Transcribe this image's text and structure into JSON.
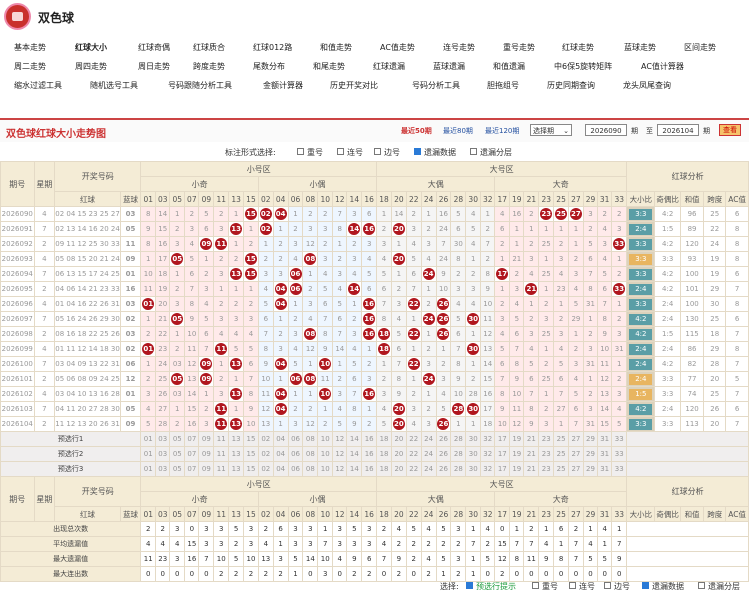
{
  "app_title": "双色球",
  "nav": [
    [
      {
        "label": "基本走势"
      },
      {
        "label": "红球大小",
        "active": true
      },
      {
        "label": "红球奇偶"
      },
      {
        "label": "红球质合"
      },
      {
        "label": "红球012路"
      },
      {
        "label": "和值走势"
      },
      {
        "label": "AC值走势"
      },
      {
        "label": "连号走势"
      },
      {
        "label": "重号走势"
      },
      {
        "label": "红球走势"
      },
      {
        "label": "蓝球走势"
      },
      {
        "label": "区间走势"
      }
    ],
    [
      {
        "label": "周二走势"
      },
      {
        "label": "周四走势"
      },
      {
        "label": "周日走势"
      },
      {
        "label": "跨度走势"
      },
      {
        "label": "尾数分布"
      },
      {
        "label": "和尾走势"
      },
      {
        "label": "红球遗漏"
      },
      {
        "label": "蓝球遗漏"
      },
      {
        "label": "和值遗漏"
      },
      {
        "label": "中6保5旋转矩阵"
      },
      {
        "label": "AC值计算器"
      }
    ],
    [
      {
        "label": "缩水过滤工具"
      },
      {
        "label": "随机选号工具"
      },
      {
        "label": "号码跟随分析工具"
      },
      {
        "label": "金额计算器"
      },
      {
        "label": "历史开奖对比"
      },
      {
        "label": "号码分析工具"
      },
      {
        "label": "胆拖组号"
      },
      {
        "label": "历史同期查询"
      },
      {
        "label": "龙头凤尾查询"
      }
    ]
  ],
  "chart_header": {
    "title": "双色球红球大小走势图",
    "recent": [
      "最近50期",
      "最近80期",
      "最近120期"
    ],
    "select_label": "选择期",
    "from_issue": "2026090",
    "period_unit": "期",
    "to_label": "至",
    "to_issue": "2026104",
    "query_button": "查看"
  },
  "options": {
    "label": "标注形式选择:",
    "items": [
      {
        "label": "重号",
        "checked": false
      },
      {
        "label": "连号",
        "checked": false
      },
      {
        "label": "边号",
        "checked": false
      },
      {
        "label": "遗漏数据",
        "checked": true
      },
      {
        "label": "遗漏分层",
        "checked": false
      }
    ]
  },
  "table": {
    "col_issue": "期号",
    "col_week": "星期",
    "col_draw": "开奖号码",
    "col_red": "红球",
    "col_blue": "蓝球",
    "zone_small": "小号区",
    "zone_big": "大号区",
    "grp_small_odd": "小奇",
    "grp_small_even": "小偶",
    "grp_big_even": "大偶",
    "grp_big_odd": "大奇",
    "analysis": "红球分析",
    "analysis_cols": [
      "大小比",
      "奇偶比",
      "和值",
      "跨度",
      "AC值"
    ],
    "sections": [
      [
        "01",
        "03",
        "05",
        "07",
        "09",
        "11",
        "13",
        "15"
      ],
      [
        "02",
        "04",
        "06",
        "08",
        "10",
        "12",
        "14",
        "16"
      ],
      [
        "18",
        "20",
        "22",
        "24",
        "26",
        "28",
        "30",
        "32"
      ],
      [
        "17",
        "19",
        "21",
        "23",
        "25",
        "27",
        "29",
        "31",
        "33"
      ]
    ],
    "rows": [
      {
        "issue": "2026090",
        "week": "4",
        "red": "02 04 15 23 25 27",
        "blue": "03",
        "cells": [
          "8",
          "14",
          "1",
          "2",
          "5",
          "2",
          "1",
          "15",
          "02",
          "04",
          "1",
          "2",
          "2",
          "7",
          "3",
          "6",
          "1",
          "14",
          "2",
          "1",
          "16",
          "5",
          "4",
          "1",
          "4",
          "16",
          "2",
          "23",
          "25",
          "27",
          "3",
          "2",
          "2"
        ],
        "ratio": "3:3",
        "oe": "4:2",
        "sum": "96",
        "span": "25",
        "ac": "6",
        "rc": 0
      },
      {
        "issue": "2026091",
        "week": "7",
        "red": "02 13 14 16 20 24",
        "blue": "05",
        "cells": [
          "9",
          "15",
          "2",
          "3",
          "6",
          "3",
          "13",
          "1",
          "02",
          "1",
          "2",
          "3",
          "3",
          "8",
          "14",
          "16",
          "2",
          "20",
          "3",
          "2",
          "24",
          "6",
          "5",
          "2",
          "6",
          "1",
          "1",
          "1",
          "1",
          "1",
          "2",
          "4",
          "3"
        ],
        "ratio": "2:4",
        "oe": "1:5",
        "sum": "89",
        "span": "22",
        "ac": "8",
        "rc": 0
      },
      {
        "issue": "2026092",
        "week": "2",
        "red": "09 11 12 25 30 33",
        "blue": "11",
        "cells": [
          "8",
          "16",
          "3",
          "4",
          "09",
          "11",
          "1",
          "2",
          "1",
          "2",
          "3",
          "12",
          "2",
          "1",
          "2",
          "3",
          "3",
          "1",
          "4",
          "3",
          "7",
          "30",
          "4",
          "7",
          "2",
          "1",
          "2",
          "25",
          "2",
          "1",
          "5",
          "3",
          "33"
        ],
        "ratio": "3:3",
        "oe": "4:2",
        "sum": "120",
        "span": "24",
        "ac": "8",
        "rc": 0
      },
      {
        "issue": "2026093",
        "week": "4",
        "red": "05 08 15 20 21 24",
        "blue": "09",
        "cells": [
          "1",
          "17",
          "05",
          "5",
          "1",
          "2",
          "2",
          "15",
          "2",
          "2",
          "4",
          "08",
          "3",
          "2",
          "3",
          "4",
          "4",
          "20",
          "5",
          "4",
          "24",
          "8",
          "1",
          "2",
          "1",
          "21",
          "3",
          "1",
          "3",
          "2",
          "6",
          "4",
          "1"
        ],
        "ratio": "3:3",
        "oe": "3:3",
        "sum": "93",
        "span": "19",
        "ac": "8",
        "rc": 1
      },
      {
        "issue": "2026094",
        "week": "7",
        "red": "06 13 15 17 24 25",
        "blue": "01",
        "cells": [
          "10",
          "18",
          "1",
          "6",
          "2",
          "3",
          "13",
          "15",
          "3",
          "3",
          "06",
          "1",
          "4",
          "3",
          "4",
          "5",
          "5",
          "1",
          "6",
          "24",
          "9",
          "2",
          "2",
          "8",
          "17",
          "2",
          "4",
          "25",
          "4",
          "3",
          "7",
          "5",
          "2"
        ],
        "ratio": "3:3",
        "oe": "4:2",
        "sum": "100",
        "span": "19",
        "ac": "6",
        "rc": 0
      },
      {
        "issue": "2026095",
        "week": "2",
        "red": "04 06 14 21 23 33",
        "blue": "16",
        "cells": [
          "11",
          "19",
          "2",
          "7",
          "3",
          "1",
          "1",
          "1",
          "4",
          "04",
          "06",
          "2",
          "5",
          "4",
          "14",
          "6",
          "6",
          "2",
          "7",
          "1",
          "10",
          "3",
          "3",
          "9",
          "1",
          "3",
          "21",
          "1",
          "23",
          "4",
          "8",
          "6",
          "33"
        ],
        "ratio": "2:4",
        "oe": "4:2",
        "sum": "101",
        "span": "29",
        "ac": "7",
        "rc": 0
      },
      {
        "issue": "2026096",
        "week": "4",
        "red": "01 04 16 22 26 31",
        "blue": "03",
        "cells": [
          "01",
          "20",
          "3",
          "8",
          "4",
          "2",
          "2",
          "2",
          "5",
          "04",
          "1",
          "3",
          "6",
          "5",
          "1",
          "16",
          "7",
          "3",
          "22",
          "2",
          "26",
          "4",
          "4",
          "10",
          "2",
          "4",
          "1",
          "2",
          "1",
          "5",
          "31",
          "7",
          "1"
        ],
        "ratio": "3:3",
        "oe": "2:4",
        "sum": "100",
        "span": "30",
        "ac": "8",
        "rc": 0
      },
      {
        "issue": "2026097",
        "week": "7",
        "red": "05 16 24 26 29 30",
        "blue": "02",
        "cells": [
          "1",
          "21",
          "05",
          "9",
          "5",
          "3",
          "3",
          "3",
          "6",
          "1",
          "2",
          "4",
          "7",
          "6",
          "2",
          "16",
          "8",
          "4",
          "1",
          "24",
          "26",
          "5",
          "30",
          "11",
          "3",
          "5",
          "2",
          "3",
          "2",
          "29",
          "1",
          "8",
          "2"
        ],
        "ratio": "4:2",
        "oe": "2:4",
        "sum": "130",
        "span": "25",
        "ac": "6",
        "rc": 0
      },
      {
        "issue": "2026098",
        "week": "2",
        "red": "08 16 18 22 25 26",
        "blue": "03",
        "cells": [
          "2",
          "22",
          "1",
          "10",
          "6",
          "4",
          "4",
          "4",
          "7",
          "2",
          "3",
          "08",
          "8",
          "7",
          "3",
          "16",
          "18",
          "5",
          "22",
          "1",
          "26",
          "6",
          "1",
          "12",
          "4",
          "6",
          "3",
          "25",
          "3",
          "1",
          "2",
          "9",
          "3"
        ],
        "ratio": "4:2",
        "oe": "1:5",
        "sum": "115",
        "span": "18",
        "ac": "7",
        "rc": 0
      },
      {
        "issue": "2026099",
        "week": "4",
        "red": "01 11 12 14 18 30",
        "blue": "02",
        "cells": [
          "01",
          "23",
          "2",
          "11",
          "7",
          "11",
          "5",
          "5",
          "8",
          "3",
          "4",
          "12",
          "9",
          "14",
          "4",
          "1",
          "18",
          "6",
          "1",
          "2",
          "1",
          "7",
          "30",
          "13",
          "5",
          "7",
          "4",
          "1",
          "4",
          "2",
          "3",
          "10",
          "31"
        ],
        "ratio": "2:4",
        "oe": "2:4",
        "sum": "86",
        "span": "29",
        "ac": "8",
        "rc": 0
      },
      {
        "issue": "2026100",
        "week": "7",
        "red": "03 04 09 13 22 31",
        "blue": "06",
        "cells": [
          "1",
          "24",
          "03",
          "12",
          "09",
          "1",
          "13",
          "6",
          "9",
          "04",
          "5",
          "1",
          "10",
          "1",
          "5",
          "2",
          "1",
          "7",
          "22",
          "3",
          "2",
          "8",
          "1",
          "14",
          "6",
          "8",
          "5",
          "2",
          "5",
          "3",
          "31",
          "11",
          "1"
        ],
        "ratio": "2:4",
        "oe": "4:2",
        "sum": "82",
        "span": "28",
        "ac": "7",
        "rc": 0
      },
      {
        "issue": "2026101",
        "week": "2",
        "red": "05 06 08 09 24 25",
        "blue": "12",
        "cells": [
          "2",
          "25",
          "05",
          "13",
          "09",
          "2",
          "1",
          "7",
          "10",
          "1",
          "06",
          "08",
          "11",
          "2",
          "6",
          "3",
          "2",
          "8",
          "1",
          "24",
          "3",
          "9",
          "2",
          "15",
          "7",
          "9",
          "6",
          "25",
          "6",
          "4",
          "1",
          "12",
          "2"
        ],
        "ratio": "2:4",
        "oe": "3:3",
        "sum": "77",
        "span": "20",
        "ac": "5",
        "rc": 1
      },
      {
        "issue": "2026102",
        "week": "4",
        "red": "03 04 10 13 16 28",
        "blue": "01",
        "cells": [
          "3",
          "26",
          "03",
          "14",
          "1",
          "3",
          "13",
          "8",
          "11",
          "04",
          "1",
          "1",
          "10",
          "3",
          "7",
          "16",
          "3",
          "9",
          "2",
          "1",
          "4",
          "10",
          "28",
          "16",
          "8",
          "10",
          "7",
          "1",
          "7",
          "5",
          "2",
          "13",
          "3"
        ],
        "ratio": "1:5",
        "oe": "3:3",
        "sum": "74",
        "span": "25",
        "ac": "7",
        "rc": 1
      },
      {
        "issue": "2026103",
        "week": "7",
        "red": "04 11 20 27 28 30",
        "blue": "05",
        "cells": [
          "4",
          "27",
          "1",
          "15",
          "2",
          "11",
          "1",
          "9",
          "12",
          "04",
          "2",
          "2",
          "1",
          "4",
          "8",
          "1",
          "4",
          "20",
          "3",
          "2",
          "5",
          "28",
          "30",
          "17",
          "9",
          "11",
          "8",
          "2",
          "27",
          "6",
          "3",
          "14",
          "4"
        ],
        "ratio": "4:2",
        "oe": "2:4",
        "sum": "120",
        "span": "26",
        "ac": "6",
        "rc": 0
      },
      {
        "issue": "2026104",
        "week": "2",
        "red": "11 12 13 20 26 31",
        "blue": "09",
        "cells": [
          "5",
          "28",
          "2",
          "16",
          "3",
          "11",
          "13",
          "10",
          "13",
          "1",
          "3",
          "12",
          "2",
          "5",
          "9",
          "2",
          "5",
          "20",
          "4",
          "3",
          "26",
          "1",
          "1",
          "18",
          "10",
          "12",
          "9",
          "3",
          "1",
          "7",
          "31",
          "15",
          "5"
        ],
        "ratio": "3:3",
        "oe": "3:3",
        "sum": "113",
        "span": "20",
        "ac": "7",
        "rc": 0
      }
    ],
    "pre_rows": [
      "预选行1",
      "预选行2",
      "预选行3"
    ],
    "stats": [
      {
        "label": "出现总次数",
        "vals": [
          "2",
          "2",
          "3",
          "0",
          "3",
          "3",
          "5",
          "3",
          "2",
          "6",
          "3",
          "3",
          "1",
          "3",
          "5",
          "3",
          "2",
          "4",
          "5",
          "4",
          "5",
          "3",
          "1",
          "4",
          "0",
          "1",
          "2",
          "1",
          "6",
          "2",
          "1",
          "4",
          "1"
        ]
      },
      {
        "label": "平均遗漏值",
        "vals": [
          "4",
          "4",
          "4",
          "15",
          "3",
          "3",
          "2",
          "3",
          "4",
          "1",
          "3",
          "3",
          "7",
          "3",
          "3",
          "3",
          "4",
          "2",
          "2",
          "2",
          "2",
          "2",
          "7",
          "2",
          "15",
          "7",
          "7",
          "4",
          "1",
          "7",
          "4",
          "1",
          "7"
        ]
      },
      {
        "label": "最大遗漏值",
        "vals": [
          "11",
          "23",
          "3",
          "16",
          "7",
          "10",
          "5",
          "10",
          "13",
          "3",
          "5",
          "14",
          "10",
          "4",
          "9",
          "6",
          "7",
          "9",
          "2",
          "4",
          "5",
          "3",
          "1",
          "5",
          "12",
          "8",
          "11",
          "9",
          "8",
          "7",
          "5",
          "5",
          "9"
        ]
      },
      {
        "label": "最大连出数",
        "vals": [
          "0",
          "0",
          "0",
          "0",
          "0",
          "2",
          "2",
          "2",
          "2",
          "2",
          "1",
          "0",
          "3",
          "0",
          "2",
          "2",
          "0",
          "2",
          "0",
          "2",
          "1",
          "2",
          "1",
          "0",
          "2",
          "0",
          "0",
          "0",
          "0",
          "0",
          "0",
          "0",
          "0"
        ]
      }
    ]
  },
  "footer": {
    "label": "选择:",
    "items": [
      {
        "label": "预选行提示",
        "checked": true,
        "accent": true
      },
      {
        "label": "重号",
        "checked": false
      },
      {
        "label": "连号",
        "checked": false
      },
      {
        "label": "边号",
        "checked": false
      },
      {
        "label": "遗漏数据",
        "checked": true
      },
      {
        "label": "遗漏分层",
        "checked": false
      }
    ]
  }
}
